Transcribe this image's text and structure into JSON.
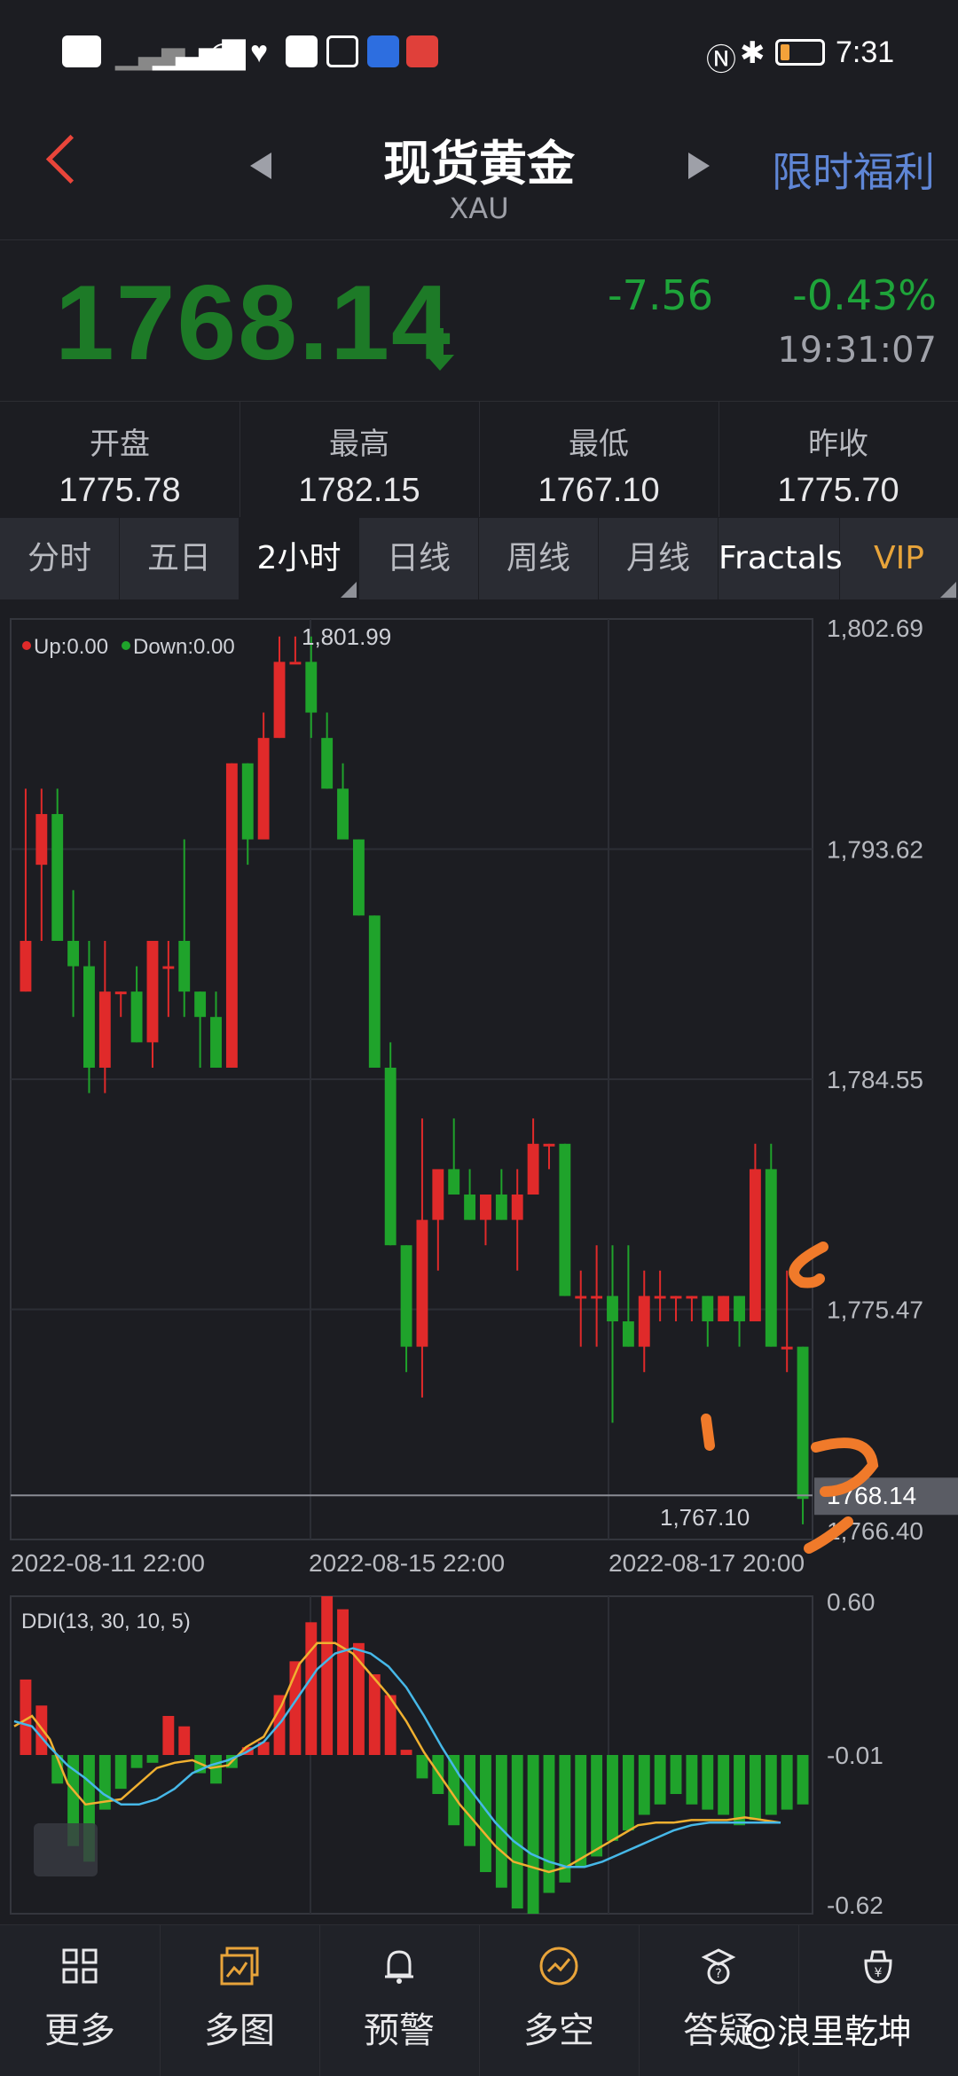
{
  "status_bar": {
    "left_icons": [
      "hd-icon",
      "signal-icon",
      "signal-5g-icon",
      "wifi-icon",
      "health-icon",
      "weibo-icon",
      "hand-icon",
      "app-icon",
      "app2-icon"
    ],
    "time": "7:31",
    "battery_color": "#f4a23a"
  },
  "header": {
    "title": "现货黄金",
    "symbol": "XAU",
    "promo": "限时福利"
  },
  "quote": {
    "price": "1768.14",
    "change": "-7.56",
    "change_pct": "-0.43%",
    "time": "19:31:07",
    "price_color": "#1d7a27",
    "change_color": "#1ea43a"
  },
  "stats": [
    {
      "label": "开盘",
      "value": "1775.78"
    },
    {
      "label": "最高",
      "value": "1782.15"
    },
    {
      "label": "最低",
      "value": "1767.10"
    },
    {
      "label": "昨收",
      "value": "1775.70"
    }
  ],
  "tabs": [
    {
      "label": "分时"
    },
    {
      "label": "五日"
    },
    {
      "label": "2小时",
      "active": true
    },
    {
      "label": "日线"
    },
    {
      "label": "周线"
    },
    {
      "label": "月线"
    },
    {
      "label": "Fractals"
    },
    {
      "label": "VIP"
    }
  ],
  "chart_data": [
    {
      "type": "candlestick",
      "legend": [
        "Up:0.00",
        "Down:0.00"
      ],
      "y_ticks": [
        "1,802.69",
        "1,793.62",
        "1,784.55",
        "1,775.47",
        "1,766.40"
      ],
      "ylim": [
        1766.4,
        1802.69
      ],
      "x_ticks": [
        "2022-08-11 22:00",
        "2022-08-15 22:00",
        "2022-08-17 20:00"
      ],
      "high_label": "1,801.99",
      "low_label": "1,767.10",
      "last_price_label": "1768.14",
      "up_color": "#e02a2a",
      "down_color": "#1fa32b",
      "candles": [
        {
          "o": 1788,
          "h": 1796,
          "l": 1788,
          "c": 1790
        },
        {
          "o": 1793,
          "h": 1796,
          "l": 1790,
          "c": 1795
        },
        {
          "o": 1795,
          "h": 1796,
          "l": 1790,
          "c": 1790
        },
        {
          "o": 1790,
          "h": 1792,
          "l": 1787,
          "c": 1789
        },
        {
          "o": 1789,
          "h": 1790,
          "l": 1784,
          "c": 1785
        },
        {
          "o": 1785,
          "h": 1790,
          "l": 1784,
          "c": 1788
        },
        {
          "o": 1788,
          "h": 1788,
          "l": 1787,
          "c": 1788
        },
        {
          "o": 1788,
          "h": 1789,
          "l": 1786,
          "c": 1786
        },
        {
          "o": 1786,
          "h": 1790,
          "l": 1785,
          "c": 1790
        },
        {
          "o": 1789,
          "h": 1790,
          "l": 1787,
          "c": 1789
        },
        {
          "o": 1790,
          "h": 1794,
          "l": 1787,
          "c": 1788
        },
        {
          "o": 1788,
          "h": 1788,
          "l": 1785,
          "c": 1787
        },
        {
          "o": 1787,
          "h": 1788,
          "l": 1785,
          "c": 1785
        },
        {
          "o": 1785,
          "h": 1797,
          "l": 1785,
          "c": 1797
        },
        {
          "o": 1797,
          "h": 1797,
          "l": 1793,
          "c": 1794
        },
        {
          "o": 1794,
          "h": 1799,
          "l": 1794,
          "c": 1798
        },
        {
          "o": 1798,
          "h": 1802,
          "l": 1798,
          "c": 1801
        },
        {
          "o": 1801,
          "h": 1802,
          "l": 1801,
          "c": 1801
        },
        {
          "o": 1801,
          "h": 1802,
          "l": 1798,
          "c": 1799
        },
        {
          "o": 1798,
          "h": 1799,
          "l": 1796,
          "c": 1796
        },
        {
          "o": 1796,
          "h": 1797,
          "l": 1794,
          "c": 1794
        },
        {
          "o": 1794,
          "h": 1794,
          "l": 1791,
          "c": 1791
        },
        {
          "o": 1791,
          "h": 1791,
          "l": 1785,
          "c": 1785
        },
        {
          "o": 1785,
          "h": 1786,
          "l": 1778,
          "c": 1778
        },
        {
          "o": 1778,
          "h": 1778,
          "l": 1773,
          "c": 1774
        },
        {
          "o": 1774,
          "h": 1783,
          "l": 1772,
          "c": 1779
        },
        {
          "o": 1779,
          "h": 1780,
          "l": 1777,
          "c": 1781
        },
        {
          "o": 1781,
          "h": 1783,
          "l": 1780,
          "c": 1780
        },
        {
          "o": 1780,
          "h": 1781,
          "l": 1779,
          "c": 1779
        },
        {
          "o": 1779,
          "h": 1780,
          "l": 1778,
          "c": 1780
        },
        {
          "o": 1780,
          "h": 1781,
          "l": 1779,
          "c": 1779
        },
        {
          "o": 1779,
          "h": 1781,
          "l": 1777,
          "c": 1780
        },
        {
          "o": 1780,
          "h": 1783,
          "l": 1780,
          "c": 1782
        },
        {
          "o": 1782,
          "h": 1782,
          "l": 1781,
          "c": 1782
        },
        {
          "o": 1782,
          "h": 1782,
          "l": 1776,
          "c": 1776
        },
        {
          "o": 1776,
          "h": 1777,
          "l": 1774,
          "c": 1776
        },
        {
          "o": 1776,
          "h": 1778,
          "l": 1774,
          "c": 1776
        },
        {
          "o": 1776,
          "h": 1778,
          "l": 1771,
          "c": 1775
        },
        {
          "o": 1775,
          "h": 1778,
          "l": 1774,
          "c": 1774
        },
        {
          "o": 1774,
          "h": 1777,
          "l": 1773,
          "c": 1776
        },
        {
          "o": 1776,
          "h": 1777,
          "l": 1775,
          "c": 1776
        },
        {
          "o": 1776,
          "h": 1776,
          "l": 1775,
          "c": 1776
        },
        {
          "o": 1776,
          "h": 1776,
          "l": 1775,
          "c": 1776
        },
        {
          "o": 1776,
          "h": 1776,
          "l": 1774,
          "c": 1775
        },
        {
          "o": 1775,
          "h": 1776,
          "l": 1775,
          "c": 1776
        },
        {
          "o": 1776,
          "h": 1776,
          "l": 1774,
          "c": 1775
        },
        {
          "o": 1775,
          "h": 1782,
          "l": 1775,
          "c": 1781
        },
        {
          "o": 1781,
          "h": 1782,
          "l": 1774,
          "c": 1774
        },
        {
          "o": 1774,
          "h": 1777,
          "l": 1773,
          "c": 1774
        },
        {
          "o": 1774,
          "h": 1774,
          "l": 1767,
          "c": 1768
        }
      ]
    },
    {
      "type": "bar",
      "title": "DDI(13, 30, 10, 5)",
      "y_ticks": [
        "0.60",
        "-0.01",
        "-0.62"
      ],
      "ylim": [
        -0.62,
        0.6
      ],
      "bars": [
        0.28,
        0.18,
        -0.12,
        -0.36,
        -0.42,
        -0.22,
        -0.14,
        -0.06,
        -0.04,
        0.14,
        0.1,
        -0.08,
        -0.12,
        -0.06,
        0.02,
        0.04,
        0.22,
        0.35,
        0.5,
        0.6,
        0.55,
        0.42,
        0.3,
        0.22,
        0.01,
        -0.1,
        -0.16,
        -0.28,
        -0.36,
        -0.46,
        -0.52,
        -0.6,
        -0.62,
        -0.54,
        -0.5,
        -0.44,
        -0.4,
        -0.34,
        -0.3,
        -0.24,
        -0.2,
        -0.16,
        -0.2,
        -0.22,
        -0.24,
        -0.28,
        -0.26,
        -0.24,
        -0.22,
        -0.2
      ],
      "series": [
        {
          "color": "#f0b030",
          "values": [
            0.1,
            0.14,
            0.05,
            -0.12,
            -0.2,
            -0.19,
            -0.18,
            -0.12,
            -0.06,
            -0.04,
            -0.03,
            -0.06,
            -0.05,
            0.02,
            0.06,
            0.18,
            0.34,
            0.42,
            0.42,
            0.38,
            0.3,
            0.22,
            0.12,
            0.0,
            -0.1,
            -0.2,
            -0.28,
            -0.36,
            -0.42,
            -0.44,
            -0.46,
            -0.44,
            -0.4,
            -0.36,
            -0.32,
            -0.28,
            -0.27,
            -0.27,
            -0.26,
            -0.26,
            -0.26,
            -0.25,
            -0.26,
            -0.27
          ]
        },
        {
          "color": "#46b8e8",
          "values": [
            0.12,
            0.1,
            0.02,
            -0.05,
            -0.1,
            -0.16,
            -0.2,
            -0.2,
            -0.18,
            -0.14,
            -0.08,
            -0.05,
            -0.03,
            0.0,
            0.04,
            0.12,
            0.22,
            0.32,
            0.38,
            0.4,
            0.38,
            0.33,
            0.25,
            0.14,
            0.02,
            -0.09,
            -0.18,
            -0.27,
            -0.34,
            -0.39,
            -0.42,
            -0.44,
            -0.44,
            -0.42,
            -0.39,
            -0.36,
            -0.33,
            -0.3,
            -0.28,
            -0.27,
            -0.27,
            -0.27,
            -0.27,
            -0.27
          ]
        }
      ]
    }
  ],
  "nav": [
    {
      "label": "更多",
      "icon": "grid-icon"
    },
    {
      "label": "多图",
      "icon": "multi-chart-icon"
    },
    {
      "label": "预警",
      "icon": "bell-icon"
    },
    {
      "label": "多空",
      "icon": "trend-icon"
    },
    {
      "label": "答疑",
      "icon": "question-icon"
    },
    {
      "label": "",
      "icon": "wallet-icon"
    }
  ],
  "watermark": "@浪里乾坤"
}
